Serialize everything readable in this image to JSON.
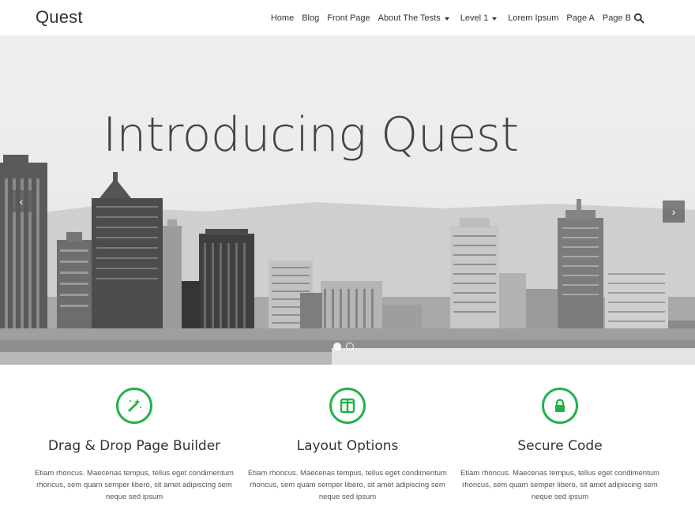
{
  "site": {
    "title": "Quest"
  },
  "nav": {
    "items": [
      {
        "label": "Home"
      },
      {
        "label": "Blog"
      },
      {
        "label": "Front Page"
      },
      {
        "label": "About The Tests",
        "dropdown": true
      },
      {
        "label": "Level 1",
        "dropdown": true
      },
      {
        "label": "Lorem Ipsum"
      },
      {
        "label": "Page A"
      },
      {
        "label": "Page B"
      }
    ],
    "search_icon": "search-icon"
  },
  "hero": {
    "title": "Introducing Quest",
    "prev_label": "‹",
    "next_label": "›",
    "slides": 2,
    "active_slide": 1
  },
  "features": [
    {
      "icon": "magic-wand-icon",
      "title": "Drag & Drop Page Builder",
      "text": "Etiam rhoncus. Maecenas tempus, tellus eget condimentum rhoncus, sem quam semper libero, sit amet adipiscing sem neque sed ipsum"
    },
    {
      "icon": "columns-icon",
      "title": "Layout Options",
      "text": "Etiam rhoncus. Maecenas tempus, tellus eget condimentum rhoncus, sem quam semper libero, sit amet adipiscing sem neque sed ipsum"
    },
    {
      "icon": "lock-icon",
      "title": "Secure Code",
      "text": "Etiam rhoncus. Maecenas tempus, tellus eget condimentum rhoncus, sem quam semper libero, sit amet adipiscing sem neque sed ipsum"
    }
  ],
  "colors": {
    "accent": "#22b24c",
    "text": "#333333"
  }
}
